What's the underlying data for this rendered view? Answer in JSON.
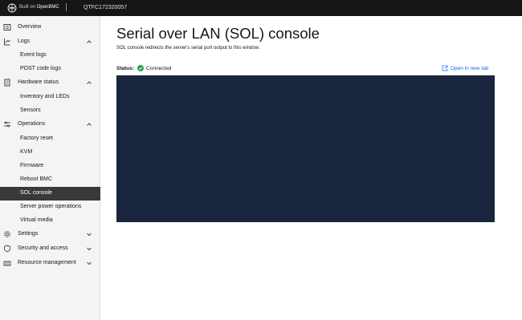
{
  "header": {
    "built_on_prefix": "Built on",
    "built_on_brand": "OpenBMC",
    "hostname": "QTFC172320057"
  },
  "sidebar": {
    "items": [
      {
        "label": "Overview",
        "icon": "overview-icon"
      },
      {
        "label": "Logs",
        "icon": "logs-icon",
        "expanded": true,
        "children": [
          "Event logs",
          "POST code logs"
        ]
      },
      {
        "label": "Hardware status",
        "icon": "hardware-status-icon",
        "expanded": true,
        "children": [
          "Inventory and LEDs",
          "Sensors"
        ]
      },
      {
        "label": "Operations",
        "icon": "operations-icon",
        "expanded": true,
        "children": [
          "Factory reset",
          "KVM",
          "Firmware",
          "Reboot BMC",
          "SOL console",
          "Server power operations",
          "Virtual media"
        ]
      },
      {
        "label": "Settings",
        "icon": "settings-icon",
        "expanded": false
      },
      {
        "label": "Security and access",
        "icon": "security-icon",
        "expanded": false
      },
      {
        "label": "Resource management",
        "icon": "resource-management-icon",
        "expanded": false
      }
    ],
    "active_item": "SOL console"
  },
  "main": {
    "title": "Serial over LAN (SOL) console",
    "description": "SOL console redirects the server's serial port output to this window.",
    "status_label": "Status:",
    "status_value": "Connected",
    "open_link": "Open in new tab"
  },
  "colors": {
    "topbar": "#161616",
    "sidebar_bg": "#f4f4f4",
    "active_bg": "#393939",
    "link": "#0f62fe",
    "success": "#24a148",
    "terminal_bg": "#19253c"
  }
}
